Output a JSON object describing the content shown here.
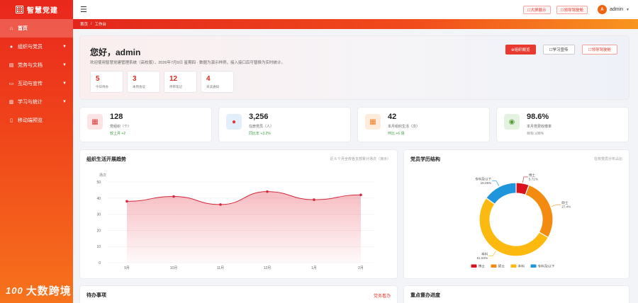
{
  "brand": {
    "name": "智慧党建"
  },
  "sidebar": {
    "items": [
      {
        "label": "首页",
        "icon": "home-icon",
        "active": true,
        "expandable": false
      },
      {
        "label": "组织与党员",
        "icon": "user-icon",
        "active": false,
        "expandable": true
      },
      {
        "label": "党务与文档",
        "icon": "document-icon",
        "active": false,
        "expandable": true
      },
      {
        "label": "互动与宣传",
        "icon": "chat-icon",
        "active": false,
        "expandable": true
      },
      {
        "label": "学习与统计",
        "icon": "chart-icon",
        "active": false,
        "expandable": true
      },
      {
        "label": "移动端预览",
        "icon": "mobile-icon",
        "active": false,
        "expandable": false
      }
    ]
  },
  "watermark": {
    "logo": "100",
    "text": "大数跨境"
  },
  "topbar": {
    "buttons": [
      "☐大屏展示",
      "☐领导驾驶舱"
    ],
    "avatar_letter": "A",
    "username": "admin"
  },
  "breadcrumb": {
    "home": "首页",
    "separator": "/",
    "current": "工作台"
  },
  "welcome": {
    "greeting": "您好，admin",
    "description": "欢迎使用智慧党建管理系统（高校版），2026年7月9日 星期四 · 数据为演示样例，接入接口后可替换为实时统计。",
    "buttons": [
      "⊕组织概览",
      "☐学习宣传",
      "☐领导驾驶舱"
    ],
    "mini_stats": [
      {
        "value": "5",
        "label": "今日待办"
      },
      {
        "value": "3",
        "label": "本周会议"
      },
      {
        "value": "12",
        "label": "待审笔记"
      },
      {
        "value": "4",
        "label": "未读通知"
      }
    ]
  },
  "stats": [
    {
      "value": "128",
      "label": "党组织（个）",
      "delta": "较上月 +2",
      "icon": "building-icon",
      "icon_bg": "#fde4e4",
      "icon_color": "#d93a3a"
    },
    {
      "value": "3,256",
      "label": "在册党员（人）",
      "delta": "同比年 +3.2%",
      "icon": "person-icon",
      "icon_bg": "#e3eefb",
      "icon_color": "#d93a3a"
    },
    {
      "value": "42",
      "label": "本月组织生活（次）",
      "delta": "环比 +6 场",
      "icon": "calendar-icon",
      "icon_bg": "#fdecdc",
      "icon_color": "#ec7d24"
    },
    {
      "value": "98.6%",
      "label": "本月党费收缴率",
      "delta": "目标 ≥98%",
      "icon": "coins-icon",
      "icon_bg": "#e4f3e0",
      "icon_color": "#5a9e3a"
    }
  ],
  "trend_panel": {
    "title": "组织生活开展趋势",
    "note": "近 6 个月全校各支部累计场次（演示）"
  },
  "edu_panel": {
    "title": "党员学历结构",
    "note": "在校党员分布占比"
  },
  "todo_panel": {
    "title": "待办事项",
    "link": "党务看办"
  },
  "progress_panel": {
    "title": "重点督办进度"
  },
  "colors": {
    "accent": "#e43a2f",
    "line": "#d6263a"
  },
  "chart_data": [
    {
      "type": "area",
      "title": "组织生活开展趋势",
      "ylabel": "场次",
      "xlabel": "",
      "categories": [
        "9月",
        "10月",
        "11月",
        "12月",
        "1月",
        "2月"
      ],
      "values": [
        38,
        41,
        36,
        44,
        39,
        42
      ],
      "ylim": [
        0,
        50
      ],
      "yticks": [
        0,
        10,
        20,
        30,
        40,
        50
      ],
      "grid": true
    },
    {
      "type": "pie",
      "title": "党员学历结构",
      "donut": true,
      "labels": [
        "博士",
        "硕士",
        "本科",
        "专科及以下"
      ],
      "values": [
        5.71,
        27.4,
        51.84,
        15.05
      ],
      "value_labels": [
        "5.71%",
        "27.4%",
        "51.84%",
        "15.05%"
      ],
      "colors": [
        "#d8131d",
        "#f28b10",
        "#fcb90f",
        "#1f95dc"
      ],
      "legend_position": "bottom"
    }
  ]
}
